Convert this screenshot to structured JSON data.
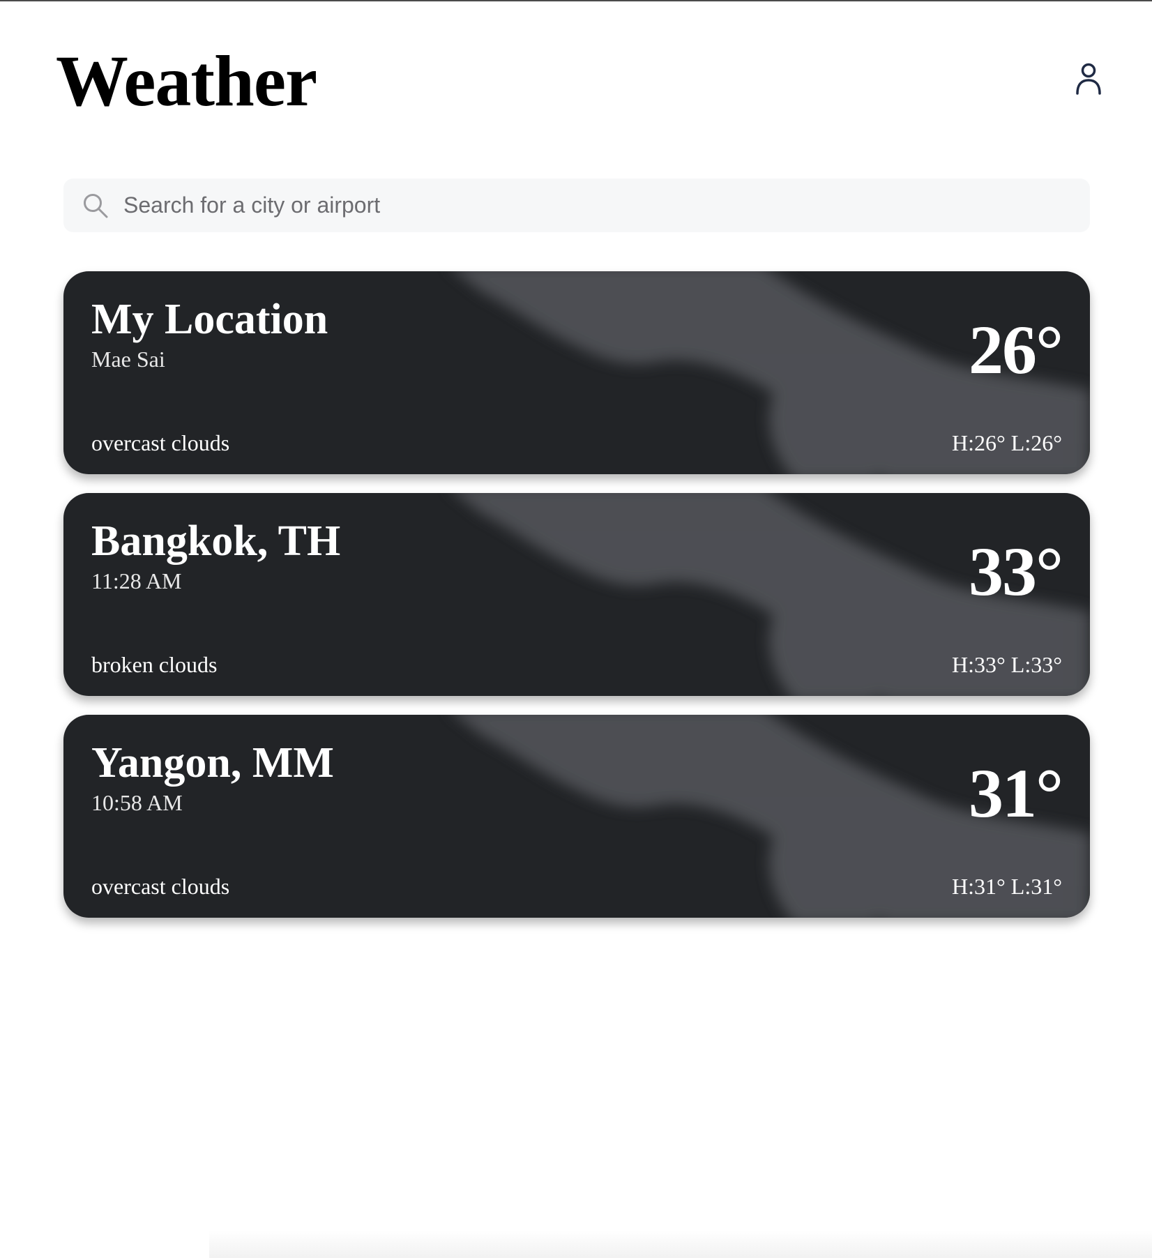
{
  "header": {
    "title": "Weather",
    "user_icon": "user-icon"
  },
  "search": {
    "icon": "search-icon",
    "placeholder": "Search for a city or airport",
    "value": ""
  },
  "cards": [
    {
      "city": "My Location",
      "subtitle": "Mae Sai",
      "description": "overcast clouds",
      "temperature": "26°",
      "high_low": "H:26° L:26°"
    },
    {
      "city": "Bangkok, TH",
      "subtitle": "11:28 AM",
      "description": "broken clouds",
      "temperature": "33°",
      "high_low": "H:33° L:33°"
    },
    {
      "city": "Yangon, MM",
      "subtitle": "10:58 AM",
      "description": "overcast clouds",
      "temperature": "31°",
      "high_low": "H:31° L:31°"
    }
  ],
  "colors": {
    "card_background": "#222427",
    "cloud": "#55575b",
    "search_background": "#f6f7f8",
    "icon_dark": "#1f2a44"
  }
}
